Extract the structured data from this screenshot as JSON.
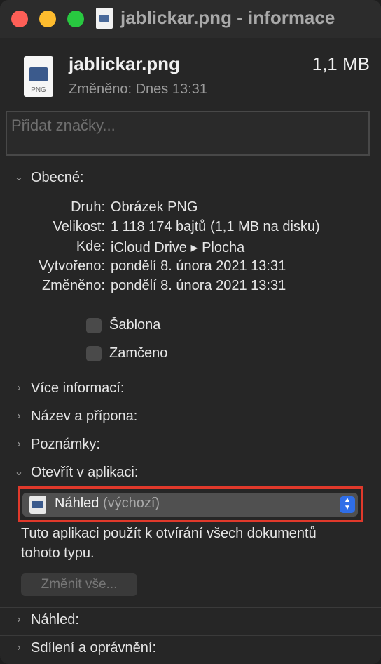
{
  "window": {
    "title": "jablickar.png - informace"
  },
  "header": {
    "file_name": "jablickar.png",
    "file_size": "1,1 MB",
    "modified": "Změněno: Dnes 13:31",
    "file_icon_ext": "PNG",
    "tags_placeholder": "Přidat značky..."
  },
  "general": {
    "label": "Obecné:",
    "rows": [
      {
        "key": "Druh:",
        "value": "Obrázek PNG"
      },
      {
        "key": "Velikost:",
        "value": "1 118 174 bajtů (1,1 MB na disku)"
      },
      {
        "key": "Kde:",
        "value": "iCloud Drive ▸ Plocha"
      },
      {
        "key": "Vytvořeno:",
        "value": "pondělí 8. února 2021 13:31"
      },
      {
        "key": "Změněno:",
        "value": "pondělí 8. února 2021 13:31"
      }
    ],
    "template_label": "Šablona",
    "locked_label": "Zamčeno"
  },
  "sections": {
    "more_info": "Více informací:",
    "name_ext": "Název a přípona:",
    "comments": "Poznámky:",
    "open_with": "Otevřít v aplikaci:",
    "preview": "Náhled:",
    "sharing": "Sdílení a oprávnění:"
  },
  "open_with": {
    "app_name": "Náhled",
    "app_default": "(výchozí)",
    "note": "Tuto aplikaci použít k otvírání všech dokumentů tohoto typu.",
    "change_all": "Změnit vše..."
  },
  "colors": {
    "highlight_border": "#e0392b",
    "stepper_accent": "#2f6ee8"
  }
}
